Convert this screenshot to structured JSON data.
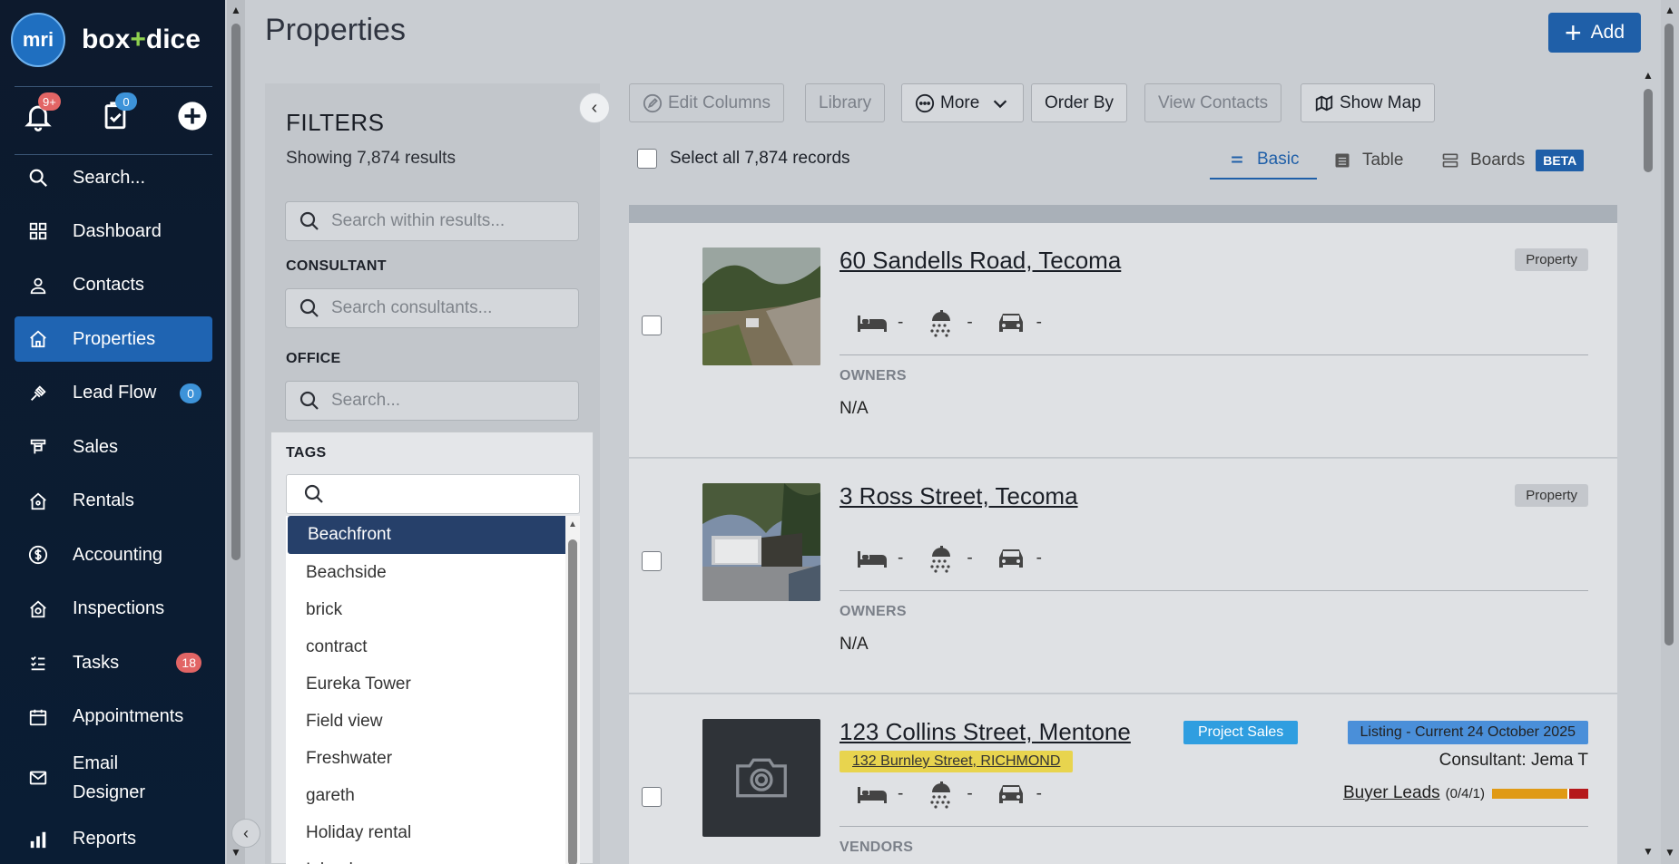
{
  "app": {
    "logo_initials": "mri",
    "logo_text_a": "box",
    "logo_text_plus": "+",
    "logo_text_b": "dice"
  },
  "quick": {
    "notifications_badge": "9+",
    "tasks_badge": "0"
  },
  "nav": {
    "search": "Search...",
    "items": [
      {
        "label": "Dashboard",
        "icon": "dashboard-icon"
      },
      {
        "label": "Contacts",
        "icon": "person-icon"
      },
      {
        "label": "Properties",
        "icon": "home-icon",
        "active": true
      },
      {
        "label": "Lead Flow",
        "icon": "lead-flow-icon",
        "badge": "0"
      },
      {
        "label": "Sales",
        "icon": "sales-icon"
      },
      {
        "label": "Rentals",
        "icon": "rentals-icon"
      },
      {
        "label": "Accounting",
        "icon": "dollar-icon"
      },
      {
        "label": "Inspections",
        "icon": "inspections-icon"
      },
      {
        "label": "Tasks",
        "icon": "tasks-icon",
        "badge": "18"
      },
      {
        "label": "Appointments",
        "icon": "calendar-icon"
      },
      {
        "label": "Email Designer",
        "icon": "mail-icon"
      },
      {
        "label": "Reports",
        "icon": "reports-icon"
      }
    ]
  },
  "header": {
    "title": "Properties",
    "add_label": "Add"
  },
  "filters": {
    "title": "FILTERS",
    "count": "Showing 7,874 results",
    "search_placeholder": "Search within results...",
    "consultant_label": "CONSULTANT",
    "consultant_placeholder": "Search consultants...",
    "office_label": "OFFICE",
    "office_placeholder": "Search...",
    "tags_label": "TAGS",
    "tags": [
      "Beachfront",
      "Beachside",
      "brick",
      "contract",
      "Eureka Tower",
      "Field view",
      "Freshwater",
      "gareth",
      "Holiday rental",
      "Inland"
    ]
  },
  "toolbar": {
    "edit_columns": "Edit Columns",
    "library": "Library",
    "more": "More",
    "order_by": "Order By",
    "view_contacts": "View Contacts",
    "show_map": "Show Map",
    "select_all": "Select all 7,874 records"
  },
  "views": {
    "basic": "Basic",
    "table": "Table",
    "boards": "Boards",
    "beta": "BETA"
  },
  "properties": [
    {
      "address": "60 Sandells Road, Tecoma",
      "type": "Property",
      "beds": "-",
      "baths": "-",
      "cars": "-",
      "people_label": "OWNERS",
      "people": "N/A"
    },
    {
      "address": "3 Ross Street, Tecoma",
      "type": "Property",
      "beds": "-",
      "baths": "-",
      "cars": "-",
      "people_label": "OWNERS",
      "people": "N/A"
    },
    {
      "address": "123 Collins Street, Mentone",
      "sub_address": "132 Burnley Street, RICHMOND",
      "project_badge": "Project Sales",
      "listing_badge": "Listing - Current 24 October 2025",
      "consultant": "Consultant: Jema T",
      "buyer_leads": "Buyer Leads",
      "buyer_leads_count": "(0/4/1)",
      "beds": "-",
      "baths": "-",
      "cars": "-",
      "people_label": "VENDORS"
    }
  ],
  "colors": {
    "sidebar_bg": "#0d1a2d",
    "accent": "#1f5fa8",
    "selected_tag": "#26406a",
    "badge_red": "#e26565",
    "badge_blue": "#3d93d9"
  }
}
